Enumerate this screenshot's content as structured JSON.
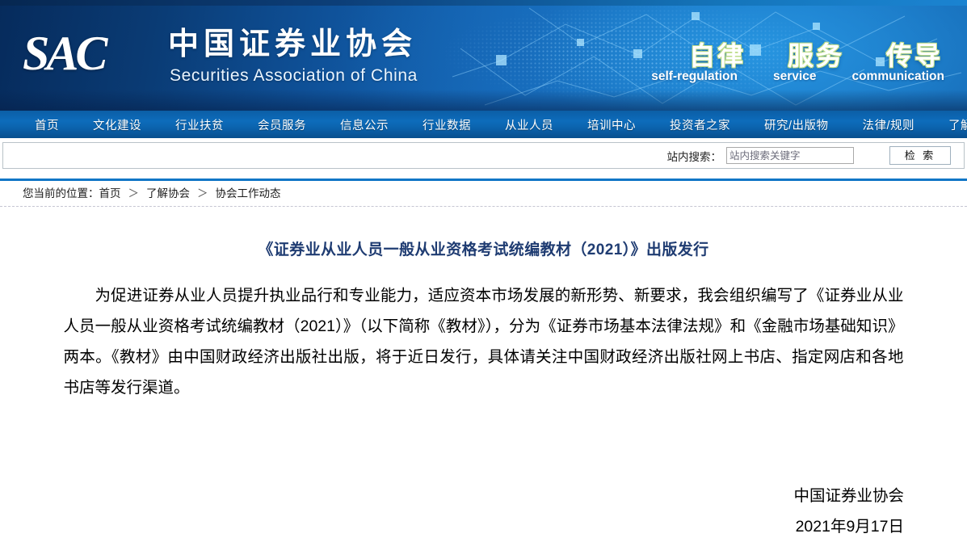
{
  "banner": {
    "logo_mark": "SAC",
    "org_name_cn": "中国证券业协会",
    "org_name_en": "Securities Association of China",
    "slogans_cn": [
      "自律",
      "服务",
      "传导"
    ],
    "slogans_en": [
      "self-regulation",
      "service",
      "communication"
    ]
  },
  "nav": {
    "items": [
      {
        "label": "首页"
      },
      {
        "label": "文化建设"
      },
      {
        "label": "行业扶贫"
      },
      {
        "label": "会员服务"
      },
      {
        "label": "信息公示"
      },
      {
        "label": "行业数据"
      },
      {
        "label": "从业人员"
      },
      {
        "label": "培训中心"
      },
      {
        "label": "投资者之家"
      },
      {
        "label": "研究/出版物"
      },
      {
        "label": "法律/规则"
      },
      {
        "label": "了解协会"
      }
    ]
  },
  "search": {
    "label": "站内搜索：",
    "value": "",
    "placeholder": "站内搜索关键字",
    "button_label": "检 索"
  },
  "breadcrumb": {
    "prefix": "您当前的位置：",
    "items": [
      "首页",
      "了解协会",
      "协会工作动态"
    ],
    "separator": "＞"
  },
  "article": {
    "title": "《证券业从业人员一般从业资格考试统编教材（2021）》出版发行",
    "body": "为促进证券从业人员提升执业品行和专业能力，适应资本市场发展的新形势、新要求，我会组织编写了《证券业从业人员一般从业资格考试统编教材（2021）》（以下简称《教材》），分为《证券市场基本法律法规》和《金融市场基础知识》两本。《教材》由中国财政经济出版社出版，将于近日发行，具体请关注中国财政经济出版社网上书店、指定网店和各地书店等发行渠道。",
    "signature_org": "中国证券业协会",
    "signature_date": "2021年9月17日"
  },
  "colors": {
    "banner_blue": "#0f529a",
    "nav_blue": "#0d6cbb",
    "rule_blue": "#1176c6",
    "title_navy": "#1f3c72"
  }
}
